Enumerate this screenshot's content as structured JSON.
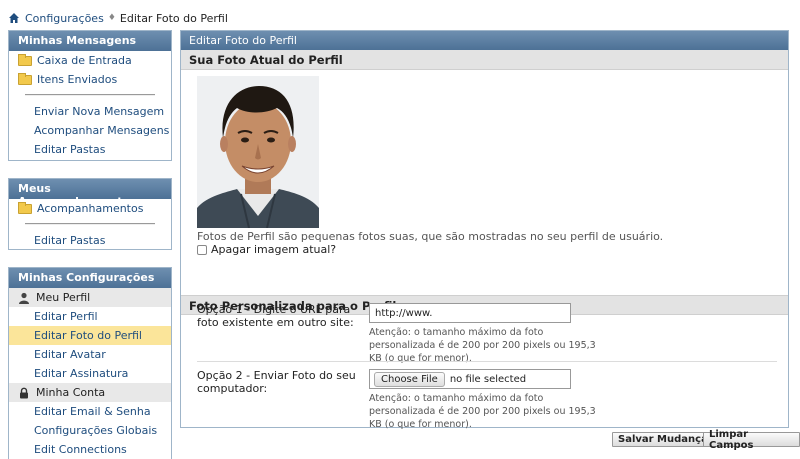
{
  "breadcrumb": {
    "parent": "Configurações",
    "current": "Editar Foto do Perfil"
  },
  "sidebar": {
    "messages": {
      "title": "Minhas Mensagens",
      "folders": [
        "Caixa de Entrada",
        "Itens Enviados"
      ],
      "links": [
        "Enviar Nova Mensagem",
        "Acompanhar Mensagens",
        "Editar Pastas"
      ]
    },
    "subscriptions": {
      "title": "Meus Acompanhamentos",
      "folders": [
        "Acompanhamentos"
      ],
      "links": [
        "Editar Pastas"
      ]
    },
    "settings": {
      "title": "Minhas Configurações",
      "profile_header": "Meu Perfil",
      "profile_links": [
        "Editar Perfil",
        "Editar Foto do Perfil",
        "Editar Avatar",
        "Editar Assinatura"
      ],
      "account_header": "Minha Conta",
      "account_links": [
        "Editar Email & Senha",
        "Configurações Globais",
        "Edit Connections"
      ]
    }
  },
  "main": {
    "title": "Editar Foto do Perfil",
    "current_section": "Sua Foto Atual do Perfil",
    "caption": "Fotos de Perfil são pequenas fotos suas, que são mostradas no seu perfil de usuário.",
    "delete_label": "Apagar imagem atual?",
    "custom_section": "Foto Personalizada para o Perfil",
    "option1": {
      "label": "Opção 1 - Digite o URL para foto existente em outro site:",
      "value": "http://www.",
      "note": "Atenção: o tamanho máximo da foto personalizada é de 200 por 200 pixels ou 195,3 KB (o que for menor)."
    },
    "option2": {
      "label": "Opção 2 - Enviar Foto do seu computador:",
      "button": "Choose File",
      "status": "no file selected",
      "note": "Atenção: o tamanho máximo da foto personalizada é de 200 por 200 pixels ou 195,3 KB (o que for menor)."
    }
  },
  "actions": {
    "save": "Salvar Mudanças",
    "reset": "Limpar Campos"
  }
}
